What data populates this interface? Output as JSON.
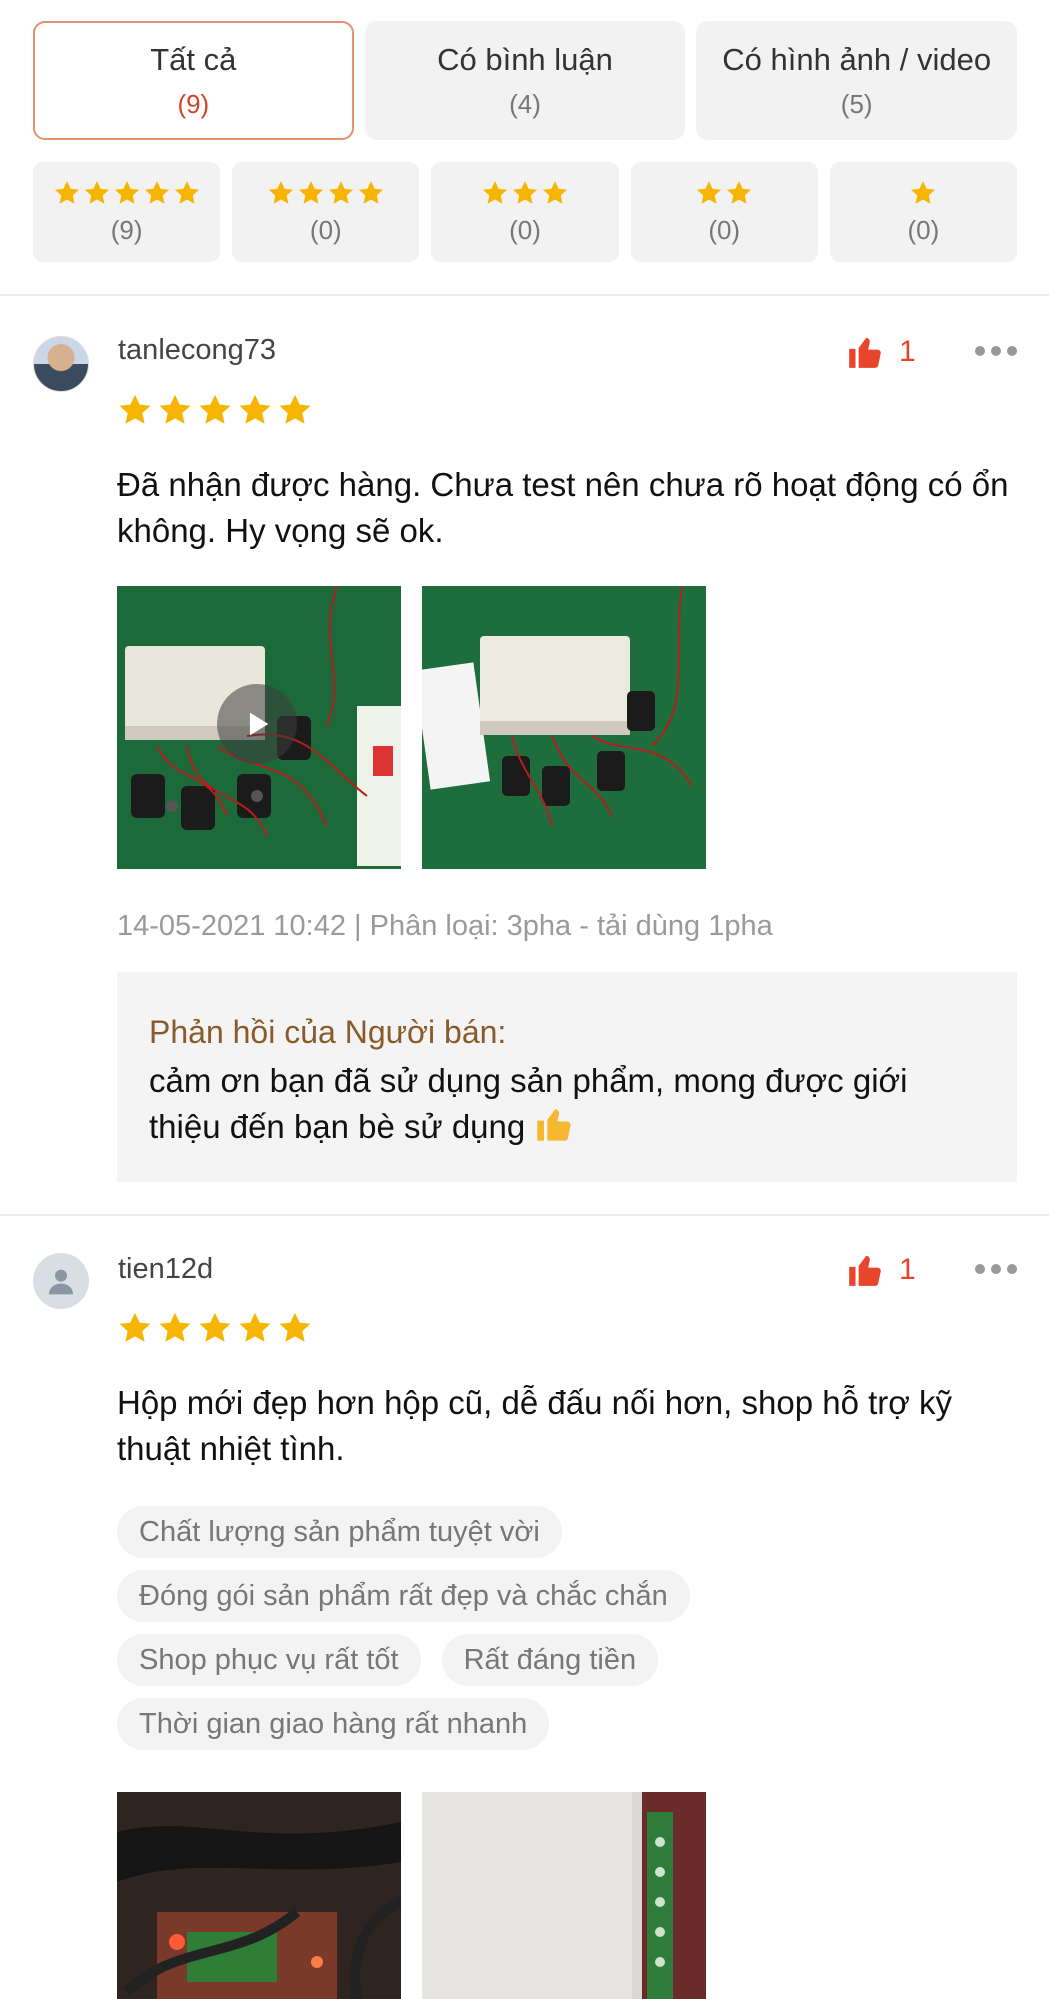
{
  "filters": {
    "tabs": [
      {
        "label": "Tất cả",
        "count": "(9)"
      },
      {
        "label": "Có bình luận",
        "count": "(4)"
      },
      {
        "label": "Có hình ảnh / video",
        "count": "(5)"
      }
    ],
    "star_filters": [
      {
        "stars": 5,
        "count": "(9)"
      },
      {
        "stars": 4,
        "count": "(0)"
      },
      {
        "stars": 3,
        "count": "(0)"
      },
      {
        "stars": 2,
        "count": "(0)"
      },
      {
        "stars": 1,
        "count": "(0)"
      }
    ],
    "star_color": "#f7b500"
  },
  "reviews": [
    {
      "username": "tanlecong73",
      "likes": "1",
      "rating": 5,
      "comment": "Đã nhận được hàng. Chưa test nên chưa rõ hoạt động có ổn không. Hy vọng sẽ ok.",
      "meta": "14-05-2021 10:42 | Phân loại: 3pha - tải dùng 1pha",
      "seller_reply": {
        "title": "Phản hồi của Người bán:",
        "text": "cảm ơn bạn đã sử dụng sản phẩm, mong được giới thiệu đến bạn bè sử dụng",
        "emoji": "thumbs-up-emoji"
      }
    },
    {
      "username": "tien12d",
      "likes": "1",
      "rating": 5,
      "comment": "Hộp mới đẹp hơn hộp cũ, dễ đấu nối hơn, shop hỗ trợ kỹ thuật nhiệt tình.",
      "tags": [
        "Chất lượng sản phẩm tuyệt vời",
        "Đóng gói sản phẩm rất đẹp và chắc chắn",
        "Shop phục vụ rất tốt",
        "Rất đáng tiền",
        "Thời gian giao hàng rất nhanh"
      ]
    }
  ],
  "colors": {
    "accent": "#e8462c",
    "active_tab_border": "#e3916f",
    "reply_title": "#8b5a2b"
  }
}
